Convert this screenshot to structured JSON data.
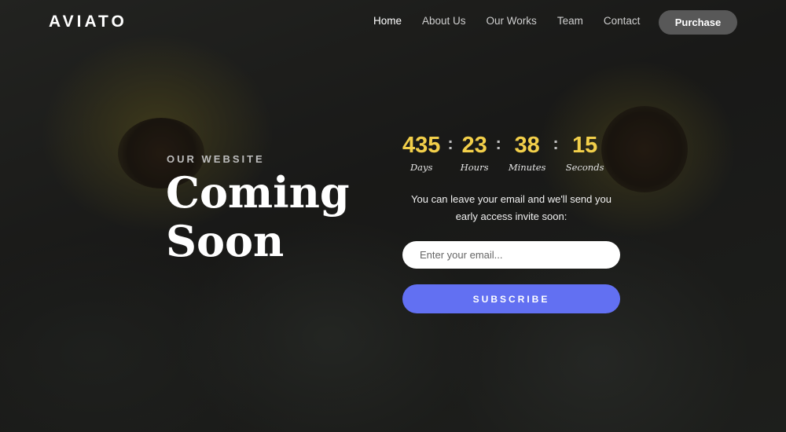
{
  "header": {
    "logo": "AVIATO",
    "nav": [
      "Home",
      "About Us",
      "Our Works",
      "Team",
      "Contact"
    ],
    "active_nav": "Home",
    "purchase_label": "Purchase"
  },
  "hero": {
    "eyebrow": "OUR WEBSITE",
    "title_line1": "Coming",
    "title_line2": "Soon"
  },
  "countdown": {
    "days": {
      "value": "435",
      "label": "Days"
    },
    "hours": {
      "value": "23",
      "label": "Hours"
    },
    "minutes": {
      "value": "38",
      "label": "Minutes"
    },
    "seconds": {
      "value": "15",
      "label": "Seconds"
    },
    "separator": ":"
  },
  "signup": {
    "description": "You can leave your email and we'll send you early access invite soon:",
    "email_placeholder": "Enter your email...",
    "email_value": "",
    "subscribe_label": "SUBSCRIBE"
  },
  "colors": {
    "accent": "#f2cf4a",
    "button": "#6270f2"
  }
}
